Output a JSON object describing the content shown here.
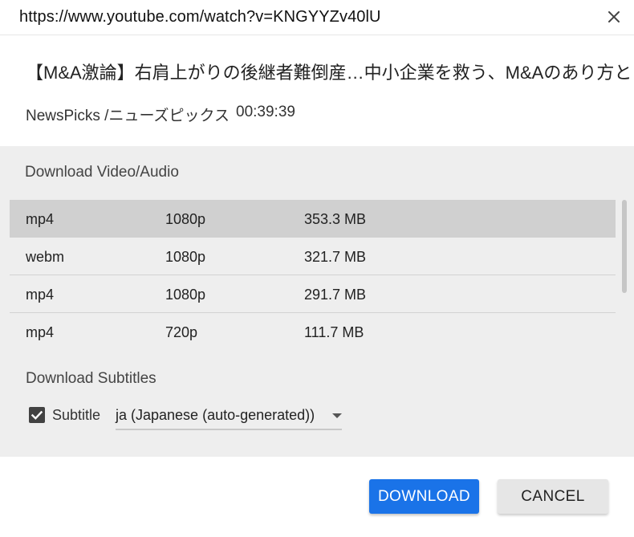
{
  "dialog": {
    "url": "https://www.youtube.com/watch?v=KNGYYZv40lU",
    "video_title": "【M&A激論】右肩上がりの後継者難倒産…中小企業を救う、M&Aのあり方と…",
    "channel": "NewsPicks /ニューズピックス",
    "duration": "00:39:39"
  },
  "download_section": {
    "heading": "Download Video/Audio",
    "formats": [
      {
        "format": "mp4",
        "resolution": "1080p",
        "size": "353.3 MB",
        "selected": true
      },
      {
        "format": "webm",
        "resolution": "1080p",
        "size": "321.7 MB",
        "selected": false
      },
      {
        "format": "mp4",
        "resolution": "1080p",
        "size": "291.7 MB",
        "selected": false
      },
      {
        "format": "mp4",
        "resolution": "720p",
        "size": "111.7 MB",
        "selected": false
      }
    ]
  },
  "subtitles_section": {
    "heading": "Download Subtitles",
    "checkbox_label": "Subtitle",
    "checked": true,
    "selected_language": "ja (Japanese (auto-generated))"
  },
  "actions": {
    "download_label": "DOWNLOAD",
    "cancel_label": "CANCEL"
  },
  "icons": {
    "close": "close-icon",
    "checkbox": "check-icon",
    "dropdown": "dropdown-arrow-icon"
  },
  "colors": {
    "primary": "#1a73e8",
    "panel_bg": "#eeeeee",
    "selected_row": "#d0d0d0"
  }
}
